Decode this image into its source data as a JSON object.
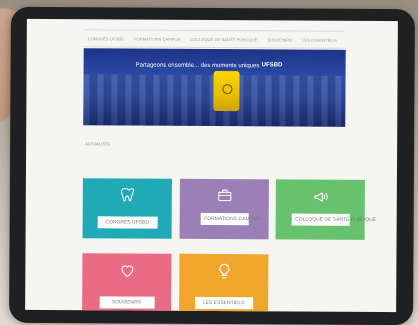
{
  "nav": {
    "items": [
      "CONGRÈS UFSBD",
      "FORMATIONS CAMPUS",
      "COLLOQUE DE SANTÉ PUBLIQUE",
      "SOUVENIRS",
      "LES ESSENTIELS"
    ]
  },
  "banner": {
    "headline": "Partageons ensemble... des moments uniques",
    "brand": "UFSBD"
  },
  "section": {
    "title": "ACTUALITÉS"
  },
  "tiles": [
    {
      "label": "CONGRÈS UFSBD",
      "color": "#20a9b7",
      "icon": "tooth-icon"
    },
    {
      "label": "FORMATIONS CAMPUS",
      "color": "#9b80b8",
      "icon": "briefcase-icon"
    },
    {
      "label": "COLLOQUE DE SANTÉ PUBLIQUE",
      "color": "#67c16d",
      "icon": "megaphone-icon"
    },
    {
      "label": "SOUVENIRS",
      "color": "#ea6c84",
      "icon": "heart-icon"
    },
    {
      "label": "LES ESSENTIELS",
      "color": "#f0a62a",
      "icon": "lightbulb-icon"
    }
  ]
}
